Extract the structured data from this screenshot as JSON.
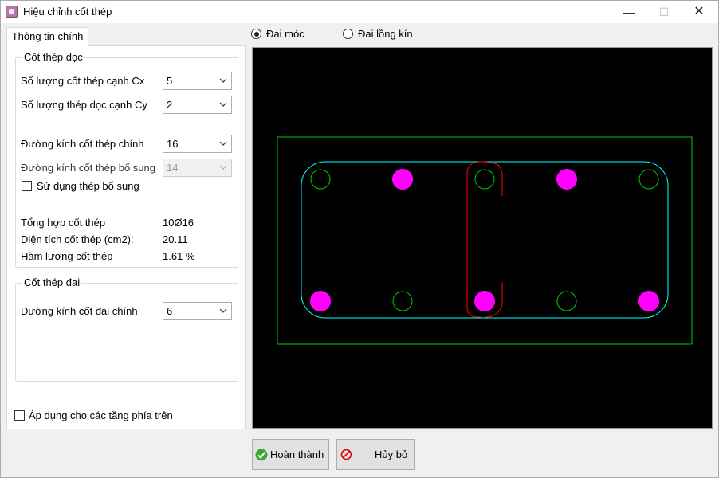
{
  "window": {
    "title": "Hiệu chỉnh cốt thép",
    "min": "—",
    "max": "☐",
    "close": "✕"
  },
  "tab": {
    "label": "Thông tin chính"
  },
  "longitudinal": {
    "title": "Cốt thép dọc",
    "cx_label": "Số lượng cốt thép cạnh Cx",
    "cx_value": "5",
    "cy_label": "Số lượng thép dọc cạnh Cy",
    "cy_value": "2",
    "main_dia_label": "Đường kính cốt thép chính",
    "main_dia_value": "16",
    "extra_dia_label": "Đường kính cốt thép bổ sung",
    "extra_dia_value": "14",
    "use_extra_label": "Sử dụng thép bổ sung",
    "summary_label": "Tổng hợp cốt thép",
    "summary_value": "10Ø16",
    "area_label": "Diện tích cốt thép (cm2):",
    "area_value": "20.11",
    "ratio_label": "Hàm lượng cốt thép",
    "ratio_value": "1.61 %"
  },
  "stirrup": {
    "title": "Cốt thép đai",
    "dia_label": "Đường kính cốt đai chính",
    "dia_value": "6"
  },
  "apply_above_label": "Áp dụng cho các tầng phía trên",
  "stirrup_type": {
    "hook_label": "Đai móc",
    "closed_label": "Đai lồng kín",
    "selected": "hook"
  },
  "buttons": {
    "ok": "Hoàn thành",
    "cancel": "Hủy bỏ"
  },
  "colors": {
    "section": "#00cc00",
    "stirrup": "#00ffff",
    "hook": "#ff0000",
    "main_bar": "#ff00ff",
    "empty_bar": "#00cc00"
  }
}
